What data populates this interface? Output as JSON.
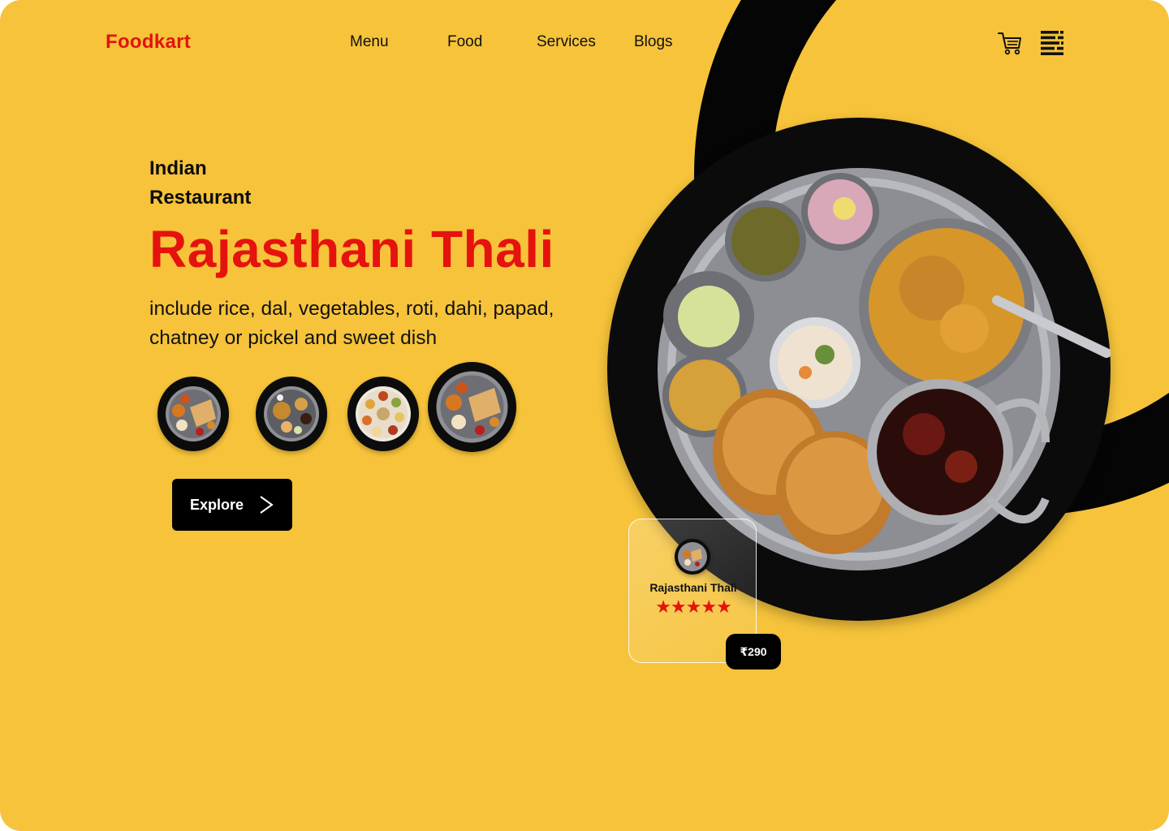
{
  "header": {
    "logo": "Foodkart",
    "nav": [
      "Menu",
      "Food",
      "Services",
      "Blogs"
    ],
    "cart_icon": "cart-icon",
    "menu_icon": "hamburger-menu-icon"
  },
  "hero": {
    "eyebrow_line1": "Indian",
    "eyebrow_line2": "Restaurant",
    "title": "Rajasthani Thali",
    "description": "include rice, dal, vegetables, roti, dahi, papad, chatney or pickel and sweet dish",
    "explore_label": "Explore",
    "explore_icon": "chevron-right-icon"
  },
  "product_card": {
    "name": "Rajasthani Thali",
    "stars": "★★★★★",
    "rating": 5,
    "price": "₹290"
  },
  "colors": {
    "background": "#F6C33A",
    "accent_red": "#E5120D",
    "black": "#000000"
  }
}
